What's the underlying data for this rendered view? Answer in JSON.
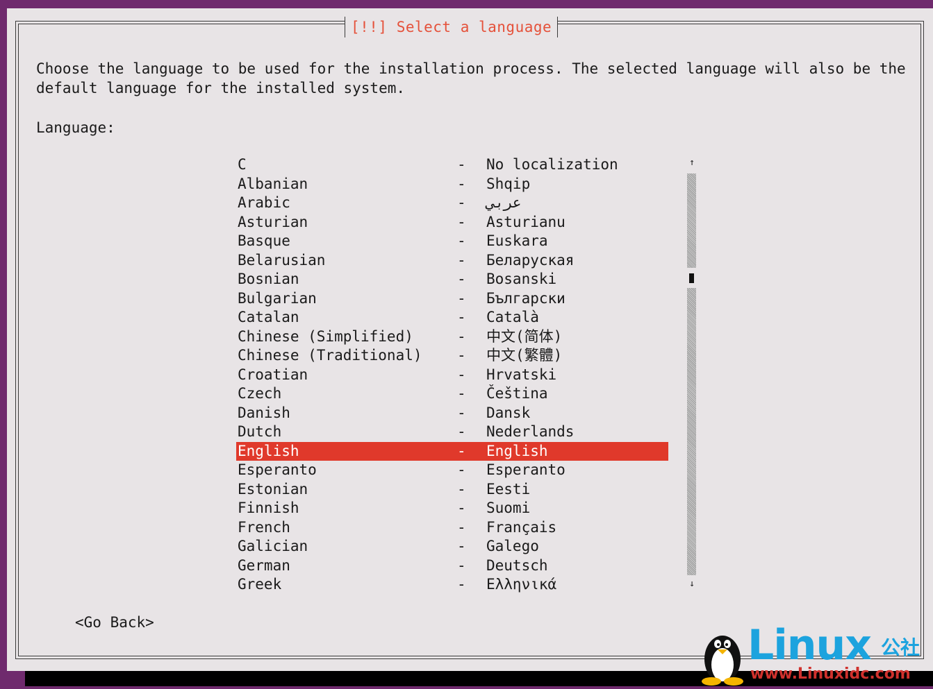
{
  "dialog": {
    "title": "[!!] Select a language",
    "description": "Choose the language to be used for the installation process. The selected language will also be the default language for the installed system.",
    "field_label": "Language:"
  },
  "languages": [
    {
      "name": "C",
      "dash": "-",
      "native": "No localization"
    },
    {
      "name": "Albanian",
      "dash": "-",
      "native": "Shqip"
    },
    {
      "name": "Arabic",
      "dash": "-",
      "native": "عربي"
    },
    {
      "name": "Asturian",
      "dash": "-",
      "native": "Asturianu"
    },
    {
      "name": "Basque",
      "dash": "-",
      "native": "Euskara"
    },
    {
      "name": "Belarusian",
      "dash": "-",
      "native": "Беларуская"
    },
    {
      "name": "Bosnian",
      "dash": "-",
      "native": "Bosanski"
    },
    {
      "name": "Bulgarian",
      "dash": "-",
      "native": "Български"
    },
    {
      "name": "Catalan",
      "dash": "-",
      "native": "Català"
    },
    {
      "name": "Chinese (Simplified)",
      "dash": "-",
      "native": "中文(简体)"
    },
    {
      "name": "Chinese (Traditional)",
      "dash": "-",
      "native": "中文(繁體)"
    },
    {
      "name": "Croatian",
      "dash": "-",
      "native": "Hrvatski"
    },
    {
      "name": "Czech",
      "dash": "-",
      "native": "Čeština"
    },
    {
      "name": "Danish",
      "dash": "-",
      "native": "Dansk"
    },
    {
      "name": "Dutch",
      "dash": "-",
      "native": "Nederlands"
    },
    {
      "name": "English",
      "dash": "-",
      "native": "English",
      "selected": true
    },
    {
      "name": "Esperanto",
      "dash": "-",
      "native": "Esperanto"
    },
    {
      "name": "Estonian",
      "dash": "-",
      "native": "Eesti"
    },
    {
      "name": "Finnish",
      "dash": "-",
      "native": "Suomi"
    },
    {
      "name": "French",
      "dash": "-",
      "native": "Français"
    },
    {
      "name": "Galician",
      "dash": "-",
      "native": "Galego"
    },
    {
      "name": "German",
      "dash": "-",
      "native": "Deutsch"
    },
    {
      "name": "Greek",
      "dash": "-",
      "native": "Ελληνικά"
    }
  ],
  "scrollbar": {
    "up_arrow": "↑",
    "down_arrow": "↓"
  },
  "buttons": {
    "go_back": "<Go Back>"
  },
  "watermark": {
    "brand": "Linux",
    "brand_cn": "公社",
    "url": "www.Linuxidc.com"
  },
  "colors": {
    "background": "#6f2a6d",
    "dialog": "#e8e4e6",
    "accent": "#e0392b",
    "title": "#e5513a"
  }
}
